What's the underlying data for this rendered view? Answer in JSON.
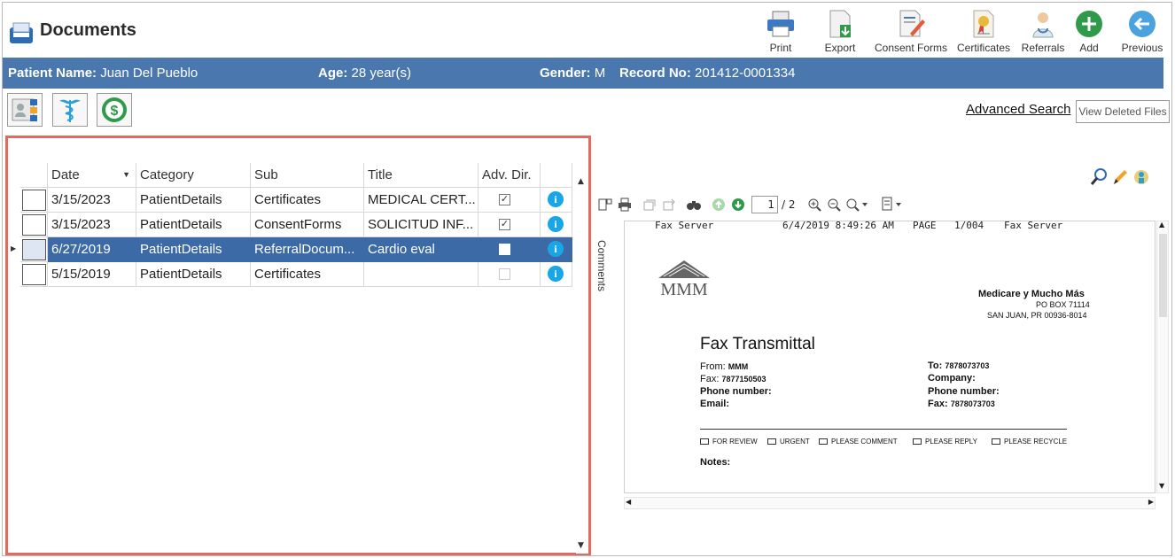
{
  "app": {
    "title": "Documents"
  },
  "toolbar": {
    "print": "Print",
    "export": "Export",
    "consent_forms": "Consent Forms",
    "certificates": "Certificates",
    "referrals": "Referrals",
    "add": "Add",
    "previous": "Previous"
  },
  "patient": {
    "name_label": "Patient Name:",
    "name": "Juan Del Pueblo",
    "age_label": "Age:",
    "age": "28 year(s)",
    "gender_label": "Gender:",
    "gender": "M",
    "record_label": "Record No:",
    "record": "201412-0001334"
  },
  "actions": {
    "advanced_search": "Advanced Search",
    "view_deleted": "View Deleted Files"
  },
  "grid": {
    "headers": [
      "Date",
      "Category",
      "Sub",
      "Title",
      "Adv. Dir."
    ],
    "rows": [
      {
        "date": "3/15/2023",
        "category": "PatientDetails",
        "sub": "Certificates",
        "title": "MEDICAL CERT...",
        "adv_dir": "checked"
      },
      {
        "date": "3/15/2023",
        "category": "PatientDetails",
        "sub": "ConsentForms",
        "title": "SOLICITUD INF...",
        "adv_dir": "checked"
      },
      {
        "date": "6/27/2019",
        "category": "PatientDetails",
        "sub": "ReferralDocum...",
        "title": "Cardio eval",
        "adv_dir": "unchecked"
      },
      {
        "date": "5/15/2019",
        "category": "PatientDetails",
        "sub": "Certificates",
        "title": "",
        "adv_dir": "unchecked"
      }
    ],
    "selected_row": 2
  },
  "viewer": {
    "page_current": "1",
    "page_total": "/ 2",
    "comments_tab": "Comments",
    "doc": {
      "fax_header_left": "Fax Server",
      "fax_header_datetime": "6/4/2019 8:49:26 AM",
      "fax_header_page": "PAGE",
      "fax_header_pagenum": "1/004",
      "fax_header_right": "Fax Server",
      "logo_text": "MMM",
      "company_name": "Medicare y Mucho Más",
      "company_addr1": "PO BOX 71114",
      "company_addr2": "SAN JUAN, PR 00936-8014",
      "heading": "Fax Transmittal",
      "from_label": "From:",
      "from_value": "MMM",
      "fax_label": "Fax:",
      "fax_value": "7877150503",
      "phone_label": "Phone number:",
      "email_label": "Email:",
      "to_label": "To:",
      "to_value": "7878073703",
      "company_label": "Company:",
      "phone2_label": "Phone number:",
      "fax2_label": "Fax:",
      "fax2_value": "7878073703",
      "options": [
        "FOR REVIEW",
        "URGENT",
        "PLEASE COMMENT",
        "PLEASE REPLY",
        "PLEASE RECYCLE"
      ],
      "notes_label": "Notes:"
    }
  },
  "colors": {
    "accent": "#4a77ad",
    "selection": "#3b6aa6",
    "highlight_border": "#e06b5e"
  }
}
